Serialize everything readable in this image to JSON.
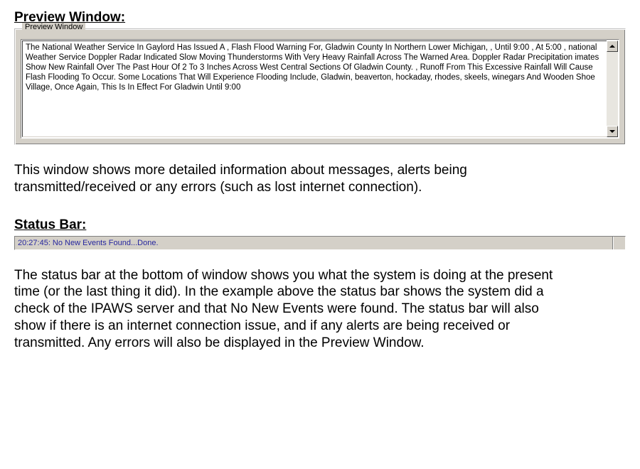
{
  "preview": {
    "heading": "Preview Window:",
    "legend": "Preview Window",
    "content": "The National Weather Service In Gaylord Has Issued A , Flash Flood Warning For,  Gladwin County In Northern Lower Michigan,  , Until 9:00  , At 5:00 , national Weather Service Doppler Radar Indicated  Slow Moving Thunderstorms With Very Heavy Rainfall Across The   Warned Area. Doppler Radar Precipitation imates Show New  Rainfall Over The Past Hour Of 2 To 3 Inches Across West Central  Sections Of Gladwin County. , Runoff From This Excessive Rainfall Will Cause Flash Flooding To  Occur. Some Locations That Will Experience Flooding Include,  Gladwin, beaverton, hockaday, rhodes, skeels, winegars And  Wooden Shoe Village,  Once Again, This Is In Effect For Gladwin Until 9:00",
    "description": "This window shows more detailed information about messages, alerts being transmitted/received or any errors (such as lost internet connection)."
  },
  "status": {
    "heading": "Status Bar:",
    "text": "20:27:45: No New Events Found...Done.",
    "description": "The status bar at the bottom of window shows you what the system is doing at the present time (or the last thing it did).  In the example above the status bar shows the system did a check of the IPAWS server and that No New Events were found.  The status bar will also show if there is an internet connection issue, and if any alerts are being received or transmitted.  Any errors will also be displayed in the Preview Window."
  }
}
